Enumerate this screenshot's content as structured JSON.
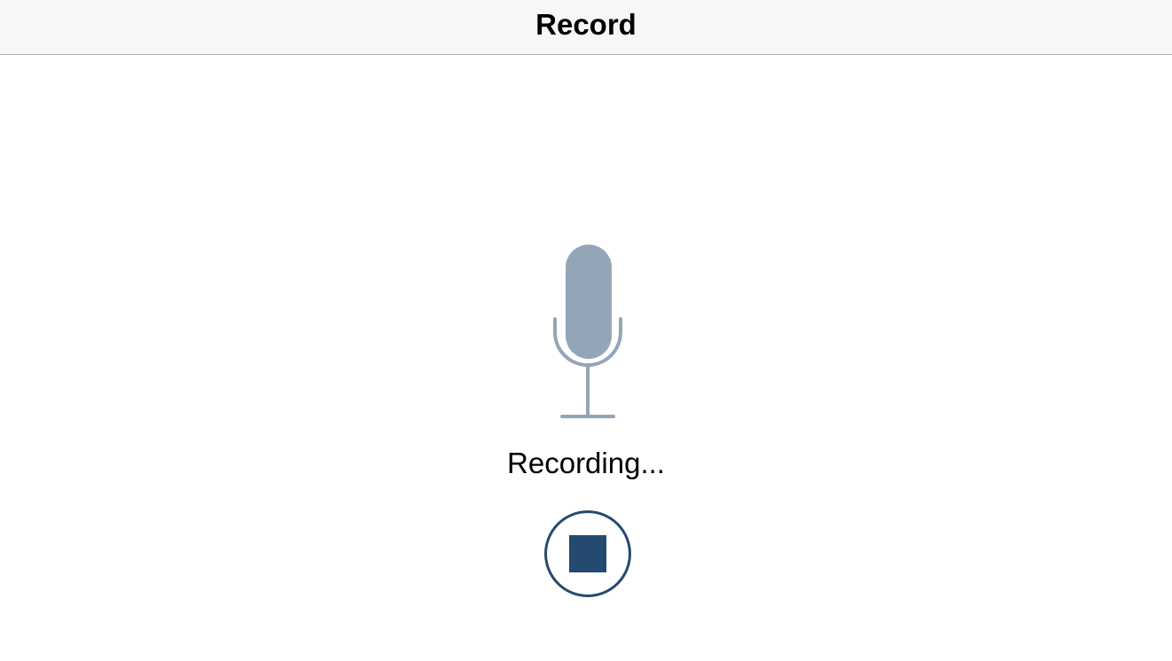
{
  "navbar": {
    "title": "Record"
  },
  "recorder": {
    "icon": "microphone-icon",
    "status_text": "Recording...",
    "stop_icon": "stop-icon"
  },
  "colors": {
    "navbar_background": "#f7f7f7",
    "microphone": "#94a5b7",
    "stop_button": "#244a70"
  }
}
